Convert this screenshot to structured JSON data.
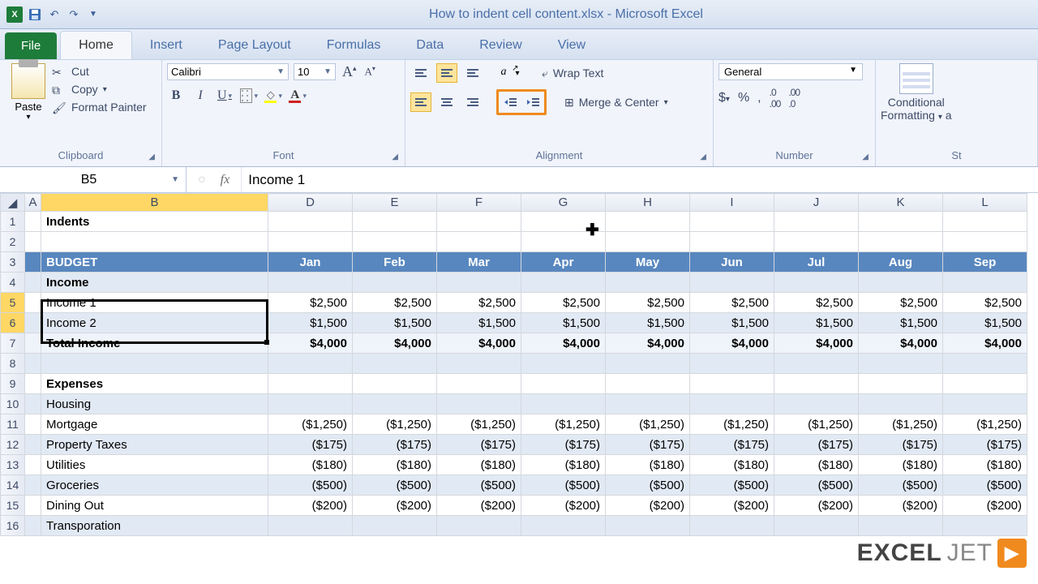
{
  "title": "How to indent cell content.xlsx - Microsoft Excel",
  "tabs": {
    "file": "File",
    "home": "Home",
    "insert": "Insert",
    "page_layout": "Page Layout",
    "formulas": "Formulas",
    "data": "Data",
    "review": "Review",
    "view": "View"
  },
  "clipboard": {
    "paste": "Paste",
    "cut": "Cut",
    "copy": "Copy",
    "format_painter": "Format Painter",
    "label": "Clipboard"
  },
  "font": {
    "name": "Calibri",
    "size": "10",
    "label": "Font"
  },
  "alignment": {
    "wrap": "Wrap Text",
    "merge": "Merge & Center",
    "label": "Alignment"
  },
  "number": {
    "format": "General",
    "label": "Number"
  },
  "styles": {
    "cond": "Conditional",
    "cond2": "Formatting",
    "label": "St"
  },
  "formula_bar": {
    "ref": "B5",
    "fx": "fx",
    "value": "Income 1"
  },
  "columns": [
    "A",
    "B",
    "D",
    "E",
    "F",
    "G",
    "H",
    "I",
    "J",
    "K",
    "L"
  ],
  "sheet": {
    "b1": "Indents",
    "header_label": "BUDGET",
    "months": [
      "Jan",
      "Feb",
      "Mar",
      "Apr",
      "May",
      "Jun",
      "Jul",
      "Aug",
      "Sep"
    ],
    "income_label": "Income",
    "income1": "Income 1",
    "income2": "Income 2",
    "total_income": "Total Income",
    "expenses": "Expenses",
    "housing": "Housing",
    "mortgage": "Mortgage",
    "property_taxes": "Property Taxes",
    "utilities": "Utilities",
    "groceries": "Groceries",
    "dining": "Dining Out",
    "transportation": "Transporation",
    "vals": {
      "i1": "$2,500",
      "i2": "$1,500",
      "ti": "$4,000",
      "mort": "($1,250)",
      "pt": "($175)",
      "ut": "($180)",
      "gr": "($500)",
      "din": "($200)"
    }
  },
  "watermark": {
    "a": "EXCEL",
    "b": "JET"
  }
}
